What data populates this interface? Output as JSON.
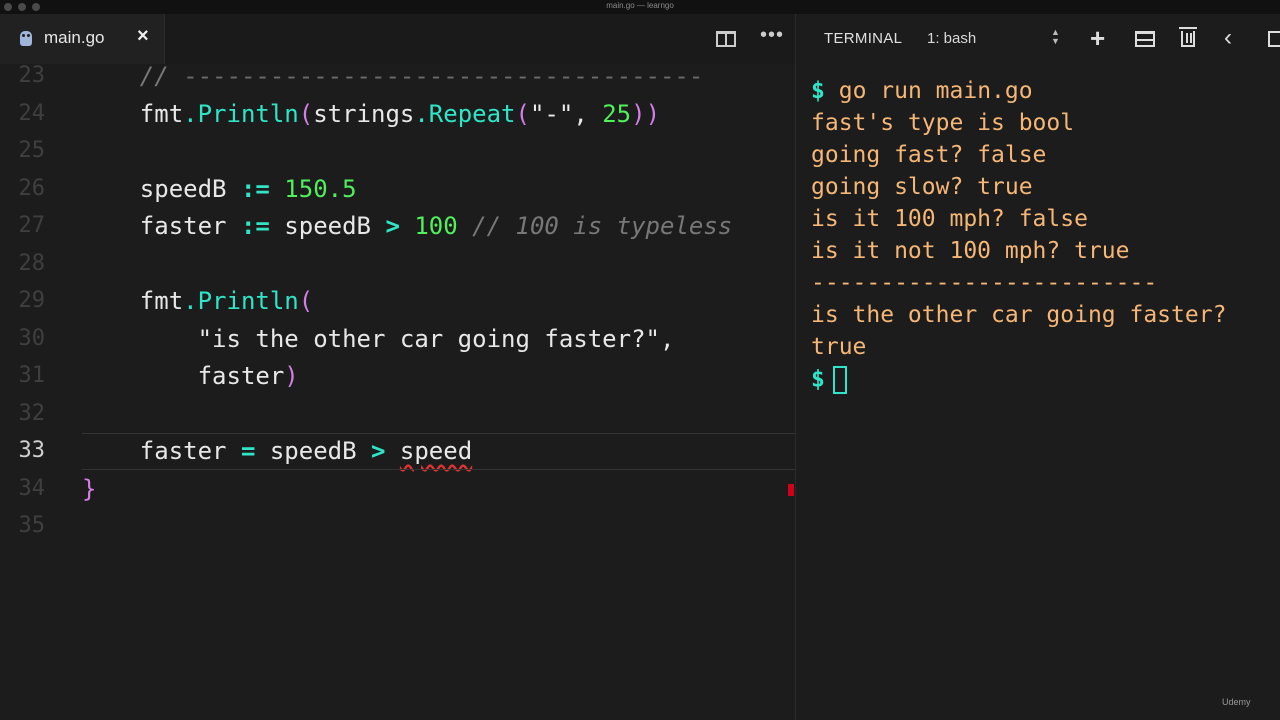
{
  "window": {
    "title": "main.go — learngo"
  },
  "editor": {
    "tab": {
      "label": "main.go",
      "close": "×"
    },
    "more": "•••",
    "lines": [
      {
        "n": "23",
        "parts": [
          [
            "c-com",
            "    // "
          ],
          [
            "c-dash",
            "------------------------------------"
          ]
        ]
      },
      {
        "n": "24",
        "parts": [
          [
            "",
            "    fmt"
          ],
          [
            "c-fn",
            ".Println"
          ],
          [
            "c-paren",
            "("
          ],
          [
            "",
            "strings"
          ],
          [
            "c-fn",
            ".Repeat"
          ],
          [
            "c-paren",
            "("
          ],
          [
            "",
            "\"-\", "
          ],
          [
            "c-num",
            "25"
          ],
          [
            "c-paren",
            "))"
          ]
        ]
      },
      {
        "n": "25",
        "parts": []
      },
      {
        "n": "26",
        "parts": [
          [
            "",
            "    speedB "
          ],
          [
            "c-op",
            ":="
          ],
          [
            "c-num",
            " 150.5"
          ]
        ]
      },
      {
        "n": "27",
        "parts": [
          [
            "",
            "    faster "
          ],
          [
            "c-op",
            ":="
          ],
          [
            "",
            " speedB "
          ],
          [
            "c-op",
            ">"
          ],
          [
            "c-num",
            " 100"
          ],
          [
            "c-com",
            " // 100 is typeless"
          ]
        ]
      },
      {
        "n": "28",
        "parts": []
      },
      {
        "n": "29",
        "parts": [
          [
            "",
            "    fmt"
          ],
          [
            "c-fn",
            ".Println"
          ],
          [
            "c-paren",
            "("
          ]
        ]
      },
      {
        "n": "30",
        "parts": [
          [
            "",
            "        \"is the other car going faster?\","
          ]
        ]
      },
      {
        "n": "31",
        "parts": [
          [
            "",
            "        faster"
          ],
          [
            "c-paren",
            ")"
          ]
        ]
      },
      {
        "n": "32",
        "parts": []
      },
      {
        "n": "33",
        "parts": [
          [
            "",
            "    faster "
          ],
          [
            "c-op",
            "="
          ],
          [
            "",
            " speedB "
          ],
          [
            "c-op",
            ">"
          ],
          [
            "",
            " "
          ],
          [
            "squig",
            "speed"
          ]
        ]
      },
      {
        "n": "34",
        "parts": [
          [
            "c-paren",
            "}"
          ]
        ]
      },
      {
        "n": "35",
        "parts": []
      }
    ],
    "active_line": "33"
  },
  "terminal": {
    "title": "TERMINAL",
    "shell": "1: bash",
    "prompt": "$",
    "command": "go run main.go",
    "output": [
      "fast's type is bool",
      "going fast? false",
      "going slow? true",
      "is it 100 mph? false",
      "is it not 100 mph? true",
      "-------------------------",
      "is the other car going faster?",
      "true"
    ]
  },
  "brand": "Udemy",
  "colors": {
    "accent": "#2ee6c7",
    "output": "#f5b676",
    "number": "#4ff05a",
    "paren": "#d47ee8",
    "error": "#d0021b"
  }
}
